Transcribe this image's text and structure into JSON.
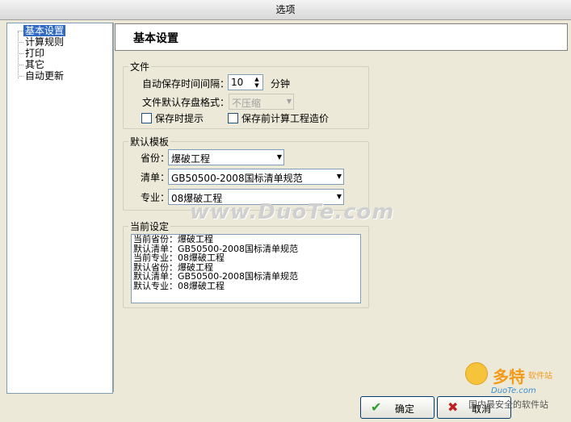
{
  "window": {
    "title": "选项"
  },
  "tree": {
    "items": [
      "基本设置",
      "计算规则",
      "打印",
      "其它",
      "自动更新"
    ],
    "selected_index": 0
  },
  "header": {
    "title": "基本设置"
  },
  "file_group": {
    "legend": "文件",
    "autosave_label": "自动保存时间间隔：",
    "autosave_value": "10",
    "autosave_unit": "分钟",
    "format_label": "文件默认存盘格式：",
    "format_value": "不压缩",
    "save_prompt_label": "保存时提示",
    "calc_before_save_label": "保存前计算工程造价"
  },
  "template_group": {
    "legend": "默认模板",
    "province_label": "省份：",
    "province_value": "爆破工程",
    "list_label": "清单：",
    "list_value": "GB50500-2008国标清单规范",
    "specialty_label": "专业：",
    "specialty_value": "08爆破工程"
  },
  "current_group": {
    "legend": "当前设定",
    "lines": [
      "当前省份：爆破工程",
      "默认清单：GB50500-2008国标清单规范",
      "当前专业：08爆破工程",
      "默认省份：爆破工程",
      "默认清单：GB50500-2008国标清单规范",
      "默认专业：08爆破工程"
    ]
  },
  "watermark": "www.DuoTe.com",
  "buttons": {
    "ok": "确定",
    "cancel": "取消"
  },
  "logo": {
    "main": "多特",
    "sub": "软件站",
    "url": "DuoTe.com",
    "tag": "国内最安全的软件站"
  },
  "colors": {
    "selection": "#316ac5",
    "ok_icon": "#2e9e2e",
    "cancel_icon": "#c02020"
  }
}
